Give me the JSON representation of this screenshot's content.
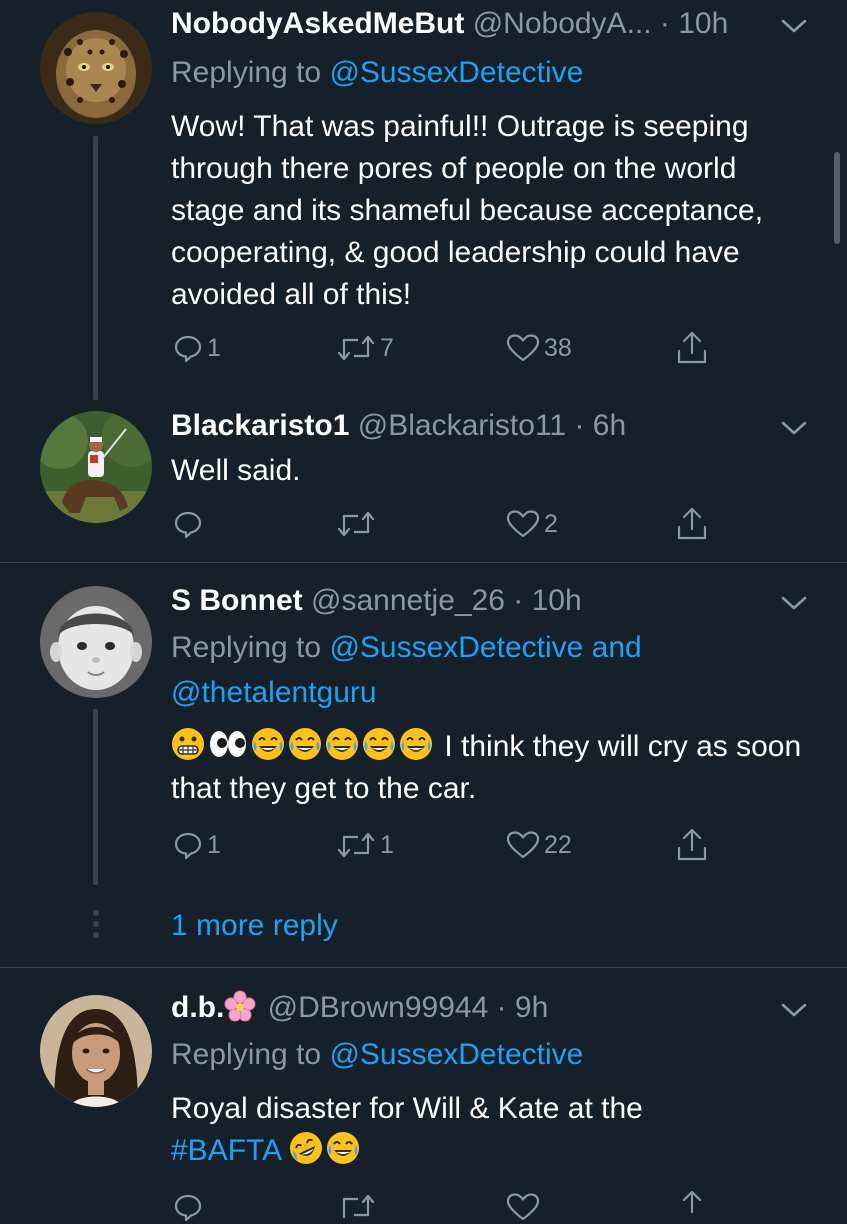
{
  "tweets": [
    {
      "name": "NobodyAskedMeBut",
      "handle": "@NobodyA...",
      "time": "· 10h",
      "replying_prefix": "Replying to",
      "replying_to": [
        "@SussexDetective"
      ],
      "text": "Wow! That was painful!! Outrage is seeping through there pores of people on the world stage and its shameful because acceptance, cooperating, & good leadership could have avoided all of this!",
      "replies": "1",
      "retweets": "7",
      "likes": "38"
    },
    {
      "name": "Blackaristo1",
      "handle": "@Blackaristo11",
      "time": "· 6h",
      "text": "Well said.",
      "replies": "",
      "retweets": "",
      "likes": "2"
    },
    {
      "name": "S Bonnet",
      "handle": "@sannetje_26",
      "time": "· 10h",
      "replying_prefix": "Replying to",
      "replying_to": [
        "@SussexDetective",
        "@thetalentguru"
      ],
      "replying_and": "and",
      "text": "I think they will cry as soon that they get to the car.",
      "emojis": [
        "grimacing",
        "eyes",
        "joy",
        "joy",
        "joy",
        "joy",
        "joy"
      ],
      "replies": "1",
      "retweets": "1",
      "likes": "22"
    },
    {
      "name": "d.b.",
      "name_emoji": "cherry-blossom",
      "handle": "@DBrown99944",
      "time": "· 9h",
      "replying_prefix": "Replying to",
      "replying_to": [
        "@SussexDetective"
      ],
      "text": "Royal disaster for Will & Kate at the",
      "hashtag": "#BAFTA",
      "emojis": [
        "rofl",
        "joy"
      ]
    }
  ],
  "more_replies": "1 more reply",
  "colors": {
    "background": "#15202b",
    "text": "#ffffff",
    "muted": "#8899a6",
    "accent": "#1da1f2",
    "divider": "#38444d"
  },
  "icons": {
    "reply": "reply-icon",
    "retweet": "retweet-icon",
    "like": "heart-icon",
    "share": "share-icon",
    "caret": "chevron-down-icon"
  }
}
